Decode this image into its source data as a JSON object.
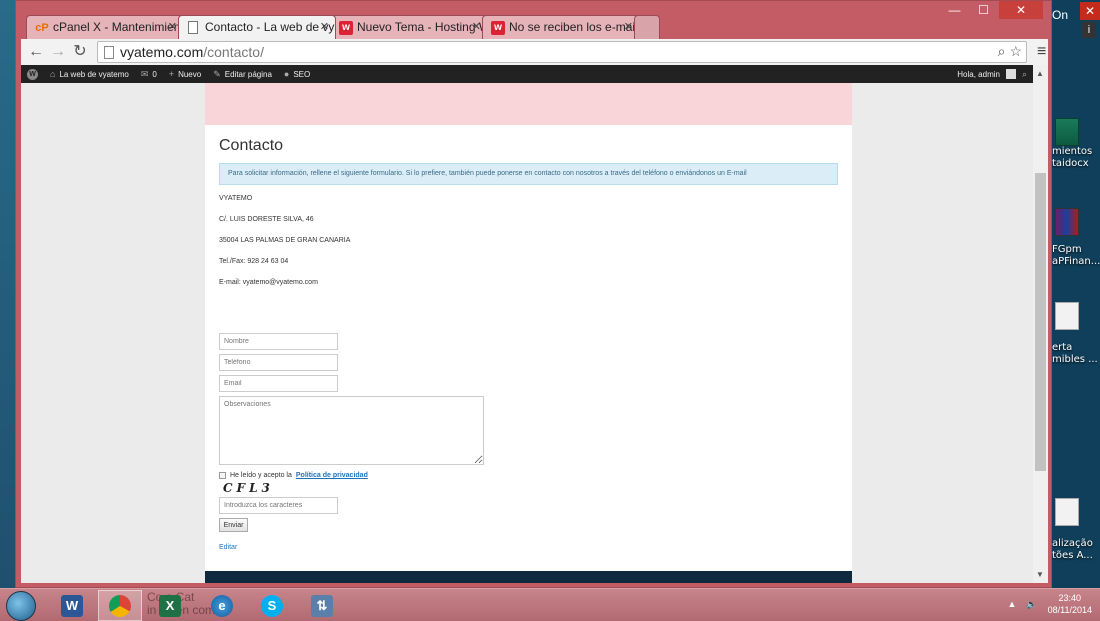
{
  "browser": {
    "tabs": [
      {
        "label": "cPanel X - Mantenimiento",
        "icon": "cpanel-icon"
      },
      {
        "label": "Contacto - La web de vyatemo",
        "icon": "page-icon"
      },
      {
        "label": "Nuevo Tema - Hosting W",
        "icon": "webempresa-icon"
      },
      {
        "label": "No se reciben los e-mail de",
        "icon": "webempresa-icon"
      }
    ],
    "url_host": "vyatemo.com",
    "url_path": "/contacto/"
  },
  "wp_admin_bar": {
    "site_name": "La web de vyatemo",
    "comments_count": "0",
    "new_label": "Nuevo",
    "edit_label": "Editar página",
    "seo_label": "SEO",
    "greeting": "Hola, admin"
  },
  "page": {
    "title": "Contacto",
    "info_text": "Para solicitar información, rellene el siguiente formulario. Si lo prefiere, también puede ponerse en contacto con nosotros a través del teléfono o enviándonos un E-mail",
    "address_lines": [
      "VYATEMO",
      "C/. LUIS DORESTE SILVA, 46",
      "35004 LAS PALMAS DE GRAN CANARIA",
      "Tel./Fax: 928 24 63 04",
      "E-mail: vyatemo@vyatemo.com"
    ],
    "form": {
      "name_placeholder": "Nombre",
      "phone_placeholder": "Teléfono",
      "email_placeholder": "Email",
      "notes_placeholder": "Observaciones",
      "privacy_prefix": "He leído y acepto la",
      "privacy_link": "Política de privacidad",
      "captcha_text": "CFL3",
      "captcha_placeholder": "Introduzca los caracteres",
      "submit_label": "Enviar"
    },
    "edit_link": "Editar"
  },
  "desktop": {
    "labels": [
      "mientos",
      "taidocx",
      "FGpm",
      "aPFinan...",
      "erta",
      "mibles ...",
      "alização",
      "tões A..."
    ],
    "corner_text": "On"
  },
  "taskbar": {
    "ghost_text_1": "Co   a Cat",
    "ghost_text_2": "in   yaten   com",
    "time": "23:40",
    "date": "08/11/2014"
  },
  "colors": {
    "window_frame": "#c45c66",
    "pink_band": "#f9d4d9",
    "info_bg": "#dbeef8",
    "link": "#1e73be",
    "footer": "#0f2a3f"
  }
}
